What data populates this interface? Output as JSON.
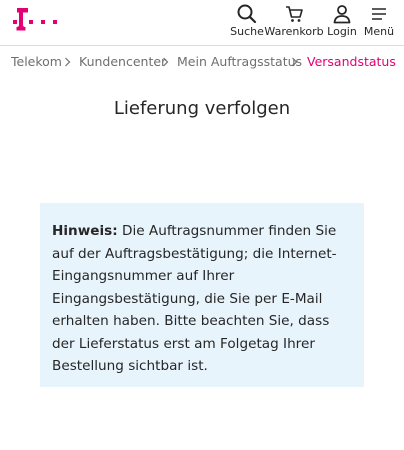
{
  "header": {
    "logo_icon": "telekom-t-logo-icon",
    "brand_color": "#e20074",
    "nav": [
      {
        "label": "Suche",
        "icon": "search-icon"
      },
      {
        "label": "Warenkorb",
        "icon": "cart-icon"
      },
      {
        "label": "Login",
        "icon": "user-icon"
      },
      {
        "label": "Menü",
        "icon": "menu-icon"
      }
    ]
  },
  "breadcrumb": {
    "items": [
      "Telekom",
      "Kundencenter",
      "Mein Auftragsstatus"
    ],
    "current": "Versandstatus"
  },
  "main": {
    "title": "Lieferung verfolgen",
    "note": {
      "label": "Hinweis:",
      "text": " Die Auftragsnummer finden Sie auf der Auftragsbestätigung; die Internet-Eingangsnummer auf Ihrer Eingangsbestätigung, die Sie per E-Mail erhalten haben. Bitte beachten Sie, dass der Lieferstatus erst am Folgetag Ihrer Bestellung sichtbar ist.",
      "background": "#e8f4fc"
    }
  }
}
